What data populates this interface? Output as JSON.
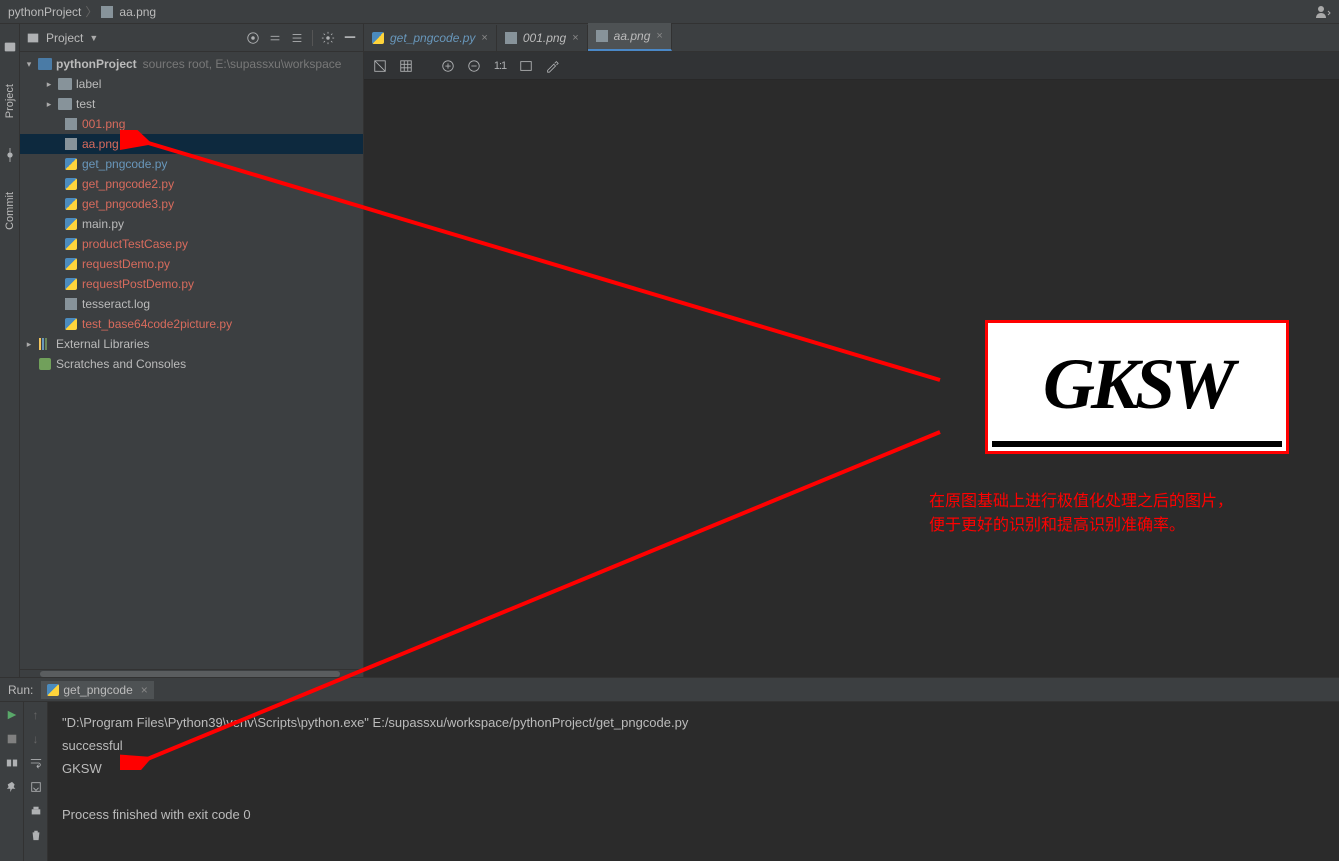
{
  "breadcrumb": {
    "project": "pythonProject",
    "file": "aa.png"
  },
  "panel": {
    "title": "Project",
    "root": "pythonProject",
    "root_hint": "sources root, E:\\supassxu\\workspace",
    "folders": {
      "label": "label",
      "test": "test"
    },
    "files": {
      "f001": "001.png",
      "aa": "aa.png",
      "gp": "get_pngcode.py",
      "gp2": "get_pngcode2.py",
      "gp3": "get_pngcode3.py",
      "main": "main.py",
      "ptc": "productTestCase.py",
      "rd": "requestDemo.py",
      "rpd": "requestPostDemo.py",
      "tl": "tesseract.log",
      "tb64": "test_base64code2picture.py"
    },
    "ext_lib": "External Libraries",
    "scratches": "Scratches and Consoles"
  },
  "tabs": {
    "t1": "get_pngcode.py",
    "t2": "001.png",
    "t3": "aa.png"
  },
  "toolbar": {
    "ratio": "1:1"
  },
  "captcha": "GKSW",
  "annotation": {
    "l1": "在原图基础上进行极值化处理之后的图片，",
    "l2": "便于更好的识别和提高识别准确率。"
  },
  "run": {
    "label": "Run:",
    "tab": "get_pngcode",
    "line1": "\"D:\\Program Files\\Python39\\venv\\Scripts\\python.exe\" E:/supassxu/workspace/pythonProject/get_pngcode.py",
    "line2": "successful",
    "line3": "GKSW",
    "line4": "",
    "line5": "Process finished with exit code 0"
  }
}
